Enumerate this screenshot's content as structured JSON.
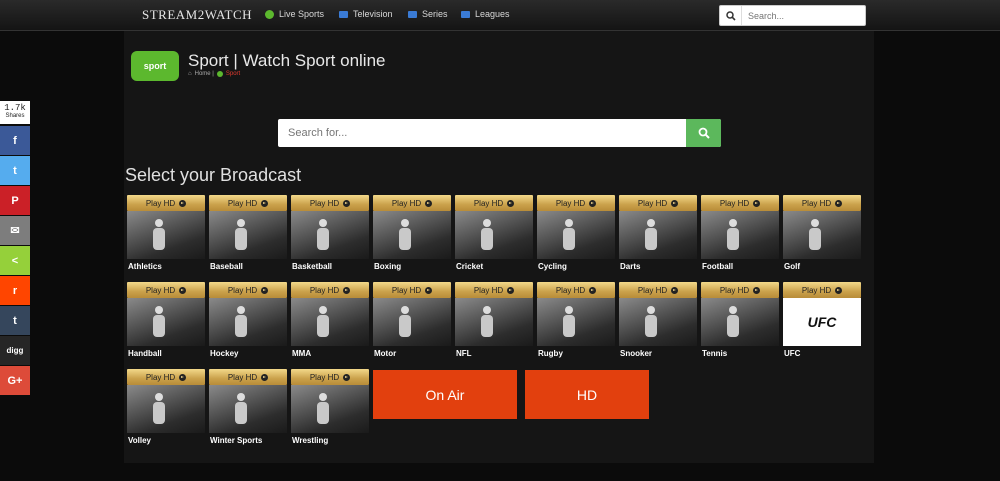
{
  "nav": {
    "logo": "STREAM2WATCH",
    "items": [
      {
        "label": "Live Sports",
        "icon": "live-sports-icon",
        "color": "#5cb82e"
      },
      {
        "label": "Television",
        "icon": "television-icon",
        "color": "#3a7bd5"
      },
      {
        "label": "Series",
        "icon": "series-icon",
        "color": "#3a7bd5"
      },
      {
        "label": "Leagues",
        "icon": "leagues-icon",
        "color": "#3a7bd5"
      }
    ],
    "search_placeholder": "Search..."
  },
  "header": {
    "logo_text": "sport",
    "title": "Sport | Watch Sport online",
    "breadcrumb_home": "Home |",
    "breadcrumb_current": "Sport"
  },
  "search": {
    "placeholder": "Search for..."
  },
  "section_title": "Select your Broadcast",
  "play_label": "Play HD",
  "sports": [
    "Athletics",
    "Baseball",
    "Basketball",
    "Boxing",
    "Cricket",
    "Cycling",
    "Darts",
    "Football",
    "Golf",
    "Handball",
    "Hockey",
    "MMA",
    "Motor",
    "NFL",
    "Rugby",
    "Snooker",
    "Tennis",
    "UFC",
    "Volley",
    "Winter Sports",
    "Wrestling"
  ],
  "ufc_logo": "UFC",
  "buttons": {
    "on_air": "On Air",
    "hd": "HD"
  },
  "share": {
    "count": "1.7k",
    "label": "Shares",
    "networks": [
      {
        "name": "facebook",
        "glyph": "f",
        "color": "#3b5998"
      },
      {
        "name": "twitter",
        "glyph": "t",
        "color": "#55acee"
      },
      {
        "name": "pinterest",
        "glyph": "P",
        "color": "#cb2027"
      },
      {
        "name": "email",
        "glyph": "✉",
        "color": "#7d7d7d"
      },
      {
        "name": "sharethis",
        "glyph": "<",
        "color": "#95d03a"
      },
      {
        "name": "reddit",
        "glyph": "r",
        "color": "#ff4500"
      },
      {
        "name": "tumblr",
        "glyph": "t",
        "color": "#35465c"
      },
      {
        "name": "digg",
        "glyph": "digg",
        "color": "#262626"
      },
      {
        "name": "googleplus",
        "glyph": "G+",
        "color": "#dd4b39"
      }
    ]
  }
}
